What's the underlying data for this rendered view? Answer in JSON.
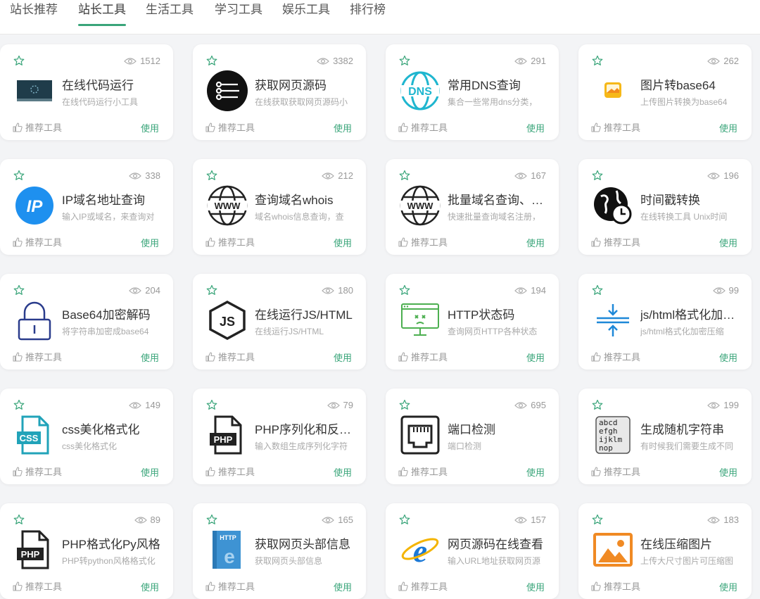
{
  "nav": {
    "tabs": [
      {
        "label": "站长推荐",
        "active": false
      },
      {
        "label": "站长工具",
        "active": true
      },
      {
        "label": "生活工具",
        "active": false
      },
      {
        "label": "学习工具",
        "active": false
      },
      {
        "label": "娱乐工具",
        "active": false
      },
      {
        "label": "排行榜",
        "active": false
      }
    ],
    "accent_color": "#3aa57a"
  },
  "card_common": {
    "recommend_label": "推荐工具",
    "use_label": "使用"
  },
  "tools": [
    {
      "title": "在线代码运行",
      "desc": "在线代码运行小工具",
      "views": "1512",
      "icon": "code-run-icon"
    },
    {
      "title": "获取网页源码",
      "desc": "在线获取获取网页源码小",
      "views": "3382",
      "icon": "webpage-source-icon"
    },
    {
      "title": "常用DNS查询",
      "desc": "集合一些常用dns分类，",
      "views": "291",
      "icon": "dns-icon"
    },
    {
      "title": "图片转base64",
      "desc": "上传图片转换为base64",
      "views": "262",
      "icon": "image-icon"
    },
    {
      "title": "IP域名地址查询",
      "desc": "输入IP或域名，来查询对",
      "views": "338",
      "icon": "ip-icon"
    },
    {
      "title": "查询域名whois",
      "desc": "域名whois信息查询，查",
      "views": "212",
      "icon": "www-globe-icon"
    },
    {
      "title": "批量域名查询、…",
      "desc": "快速批量查询域名注册，",
      "views": "167",
      "icon": "www-globe-icon"
    },
    {
      "title": "时间戳转换",
      "desc": "在线转换工具 Unix时间",
      "views": "196",
      "icon": "globe-clock-icon"
    },
    {
      "title": "Base64加密解码",
      "desc": "将字符串加密成base64",
      "views": "204",
      "icon": "lock-icon"
    },
    {
      "title": "在线运行JS/HTML",
      "desc": "在线运行JS/HTML",
      "views": "180",
      "icon": "js-hexagon-icon"
    },
    {
      "title": "HTTP状态码",
      "desc": "查询网页HTTP各种状态",
      "views": "194",
      "icon": "http-status-icon"
    },
    {
      "title": "js/html格式化加…",
      "desc": "js/html格式化加密压缩",
      "views": "99",
      "icon": "compress-arrows-icon"
    },
    {
      "title": "css美化格式化",
      "desc": "css美化格式化",
      "views": "149",
      "icon": "css-file-icon"
    },
    {
      "title": "PHP序列化和反…",
      "desc": "输入数组生成序列化字符",
      "views": "79",
      "icon": "php-file-icon"
    },
    {
      "title": "端口检测",
      "desc": "端口检测",
      "views": "695",
      "icon": "port-icon"
    },
    {
      "title": "生成随机字符串",
      "desc": "有时候我们需要生成不同",
      "views": "199",
      "icon": "random-string-icon"
    },
    {
      "title": "PHP格式化Py风格",
      "desc": "PHP转python风格格式化",
      "views": "89",
      "icon": "php-file-icon"
    },
    {
      "title": "获取网页头部信息",
      "desc": "获取网页头部信息",
      "views": "165",
      "icon": "http-book-icon"
    },
    {
      "title": "网页源码在线查看",
      "desc": "输入URL地址获取网页源",
      "views": "157",
      "icon": "ie-browser-icon"
    },
    {
      "title": "在线压缩图片",
      "desc": "上传大尺寸图片可压缩图",
      "views": "183",
      "icon": "picture-icon"
    }
  ]
}
